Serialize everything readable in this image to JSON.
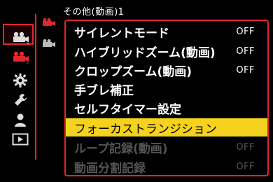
{
  "header": {
    "title": "その他(動画)1"
  },
  "menu": {
    "items": [
      {
        "label": "サイレントモード",
        "value": "OFF"
      },
      {
        "label": "ハイブリッドズーム(動画)",
        "value": "OFF"
      },
      {
        "label": "クロップズーム(動画)",
        "value": "OFF"
      },
      {
        "label": "手ブレ補正",
        "value": ""
      },
      {
        "label": "セルフタイマー設定",
        "value": ""
      },
      {
        "label": "フォーカストランジション",
        "value": ""
      },
      {
        "label": "ループ記録(動画)",
        "value": "OFF"
      },
      {
        "label": "動画分割記録",
        "value": "OFF"
      }
    ],
    "selected_index": 5,
    "disabled_indices": [
      6,
      7
    ]
  },
  "colors": {
    "accent": "#e3262d",
    "highlight": "#f4d21d",
    "disabled": "#555555"
  },
  "rail": {
    "icons": [
      "photo-settings-icon",
      "video-settings-icon",
      "custom-gear-icon",
      "setup-wrench-icon",
      "my-menu-person-icon",
      "playback-icon"
    ],
    "active": "video-settings-icon"
  },
  "subtabs": {
    "icons": [
      "video-tab-icon",
      "video-tab-secondary-icon"
    ],
    "active": "video-tab-icon"
  }
}
